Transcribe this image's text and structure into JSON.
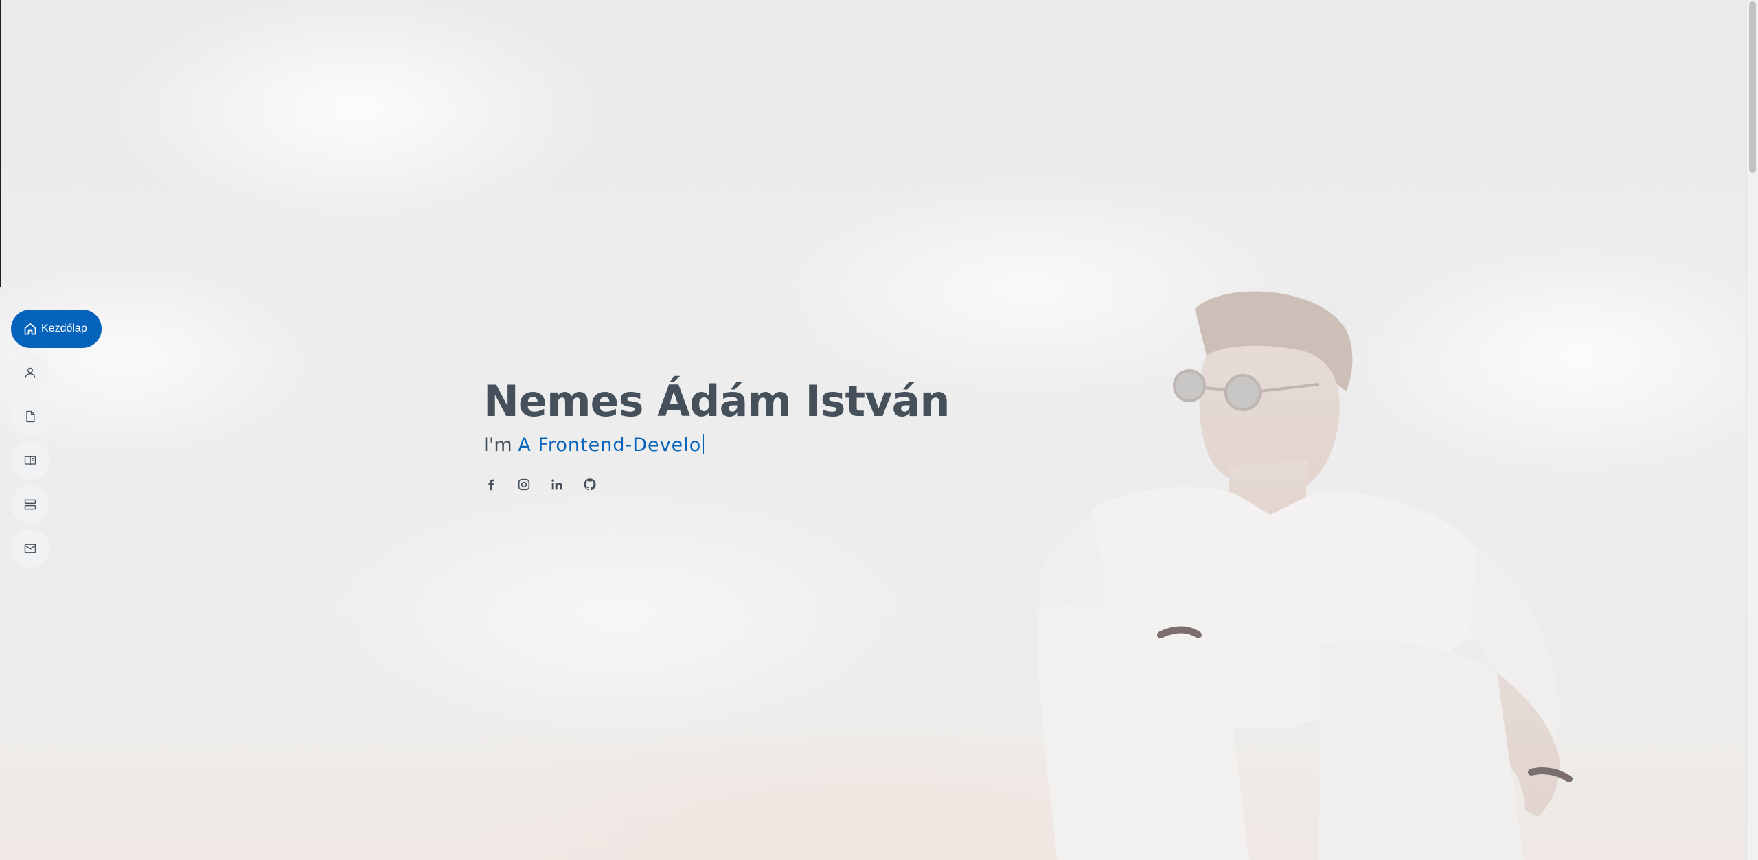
{
  "hero": {
    "name": "Nemes Ádám István",
    "subtitle_prefix": "I'm",
    "typed_text": "A Frontend-Develo"
  },
  "nav": {
    "items": [
      {
        "label": "Kezdőlap",
        "icon": "home-icon",
        "active": true
      },
      {
        "label": "",
        "icon": "person-icon",
        "active": false
      },
      {
        "label": "",
        "icon": "file-icon",
        "active": false
      },
      {
        "label": "",
        "icon": "book-icon",
        "active": false
      },
      {
        "label": "",
        "icon": "server-icon",
        "active": false
      },
      {
        "label": "",
        "icon": "envelope-icon",
        "active": false
      }
    ]
  },
  "social": [
    "facebook-icon",
    "instagram-icon",
    "linkedin-icon",
    "github-icon"
  ],
  "colors": {
    "accent": "#0563bb",
    "text": "#45505b",
    "nav_bg": "#f1f2f3"
  }
}
